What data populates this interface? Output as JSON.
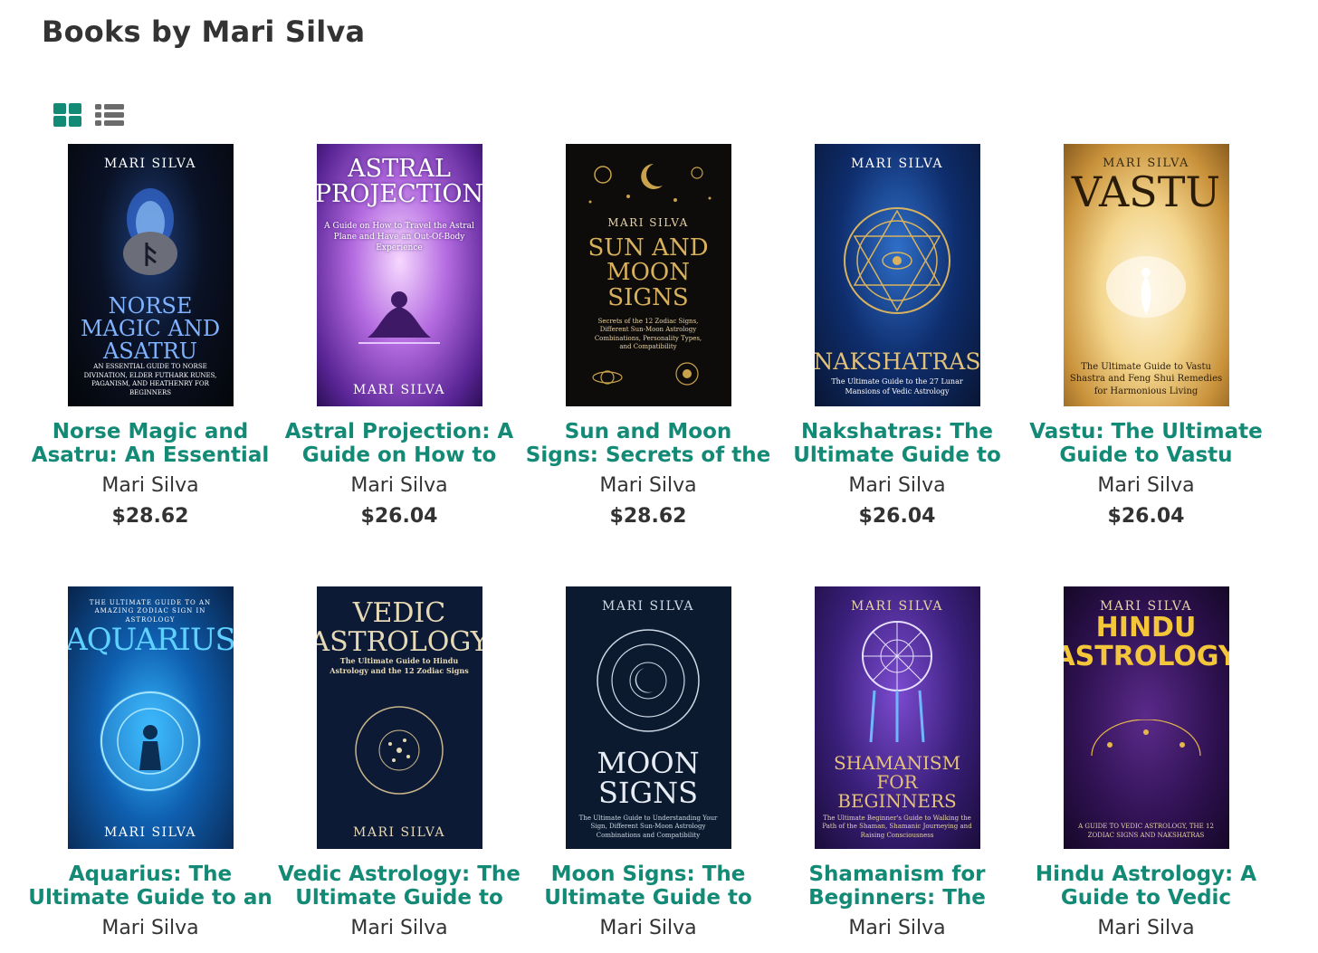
{
  "page": {
    "title": "Books by Mari Silva"
  },
  "view_toggle": {
    "grid_icon": "grid-view-icon",
    "list_icon": "list-view-icon",
    "accent_color": "#138a76"
  },
  "books": [
    {
      "title": "Norse Magic and Asatru: An Essential",
      "author": "Mari Silva",
      "price": "$28.62",
      "cover": {
        "author": "MARI SILVA",
        "title": "Norse Magic and Asatru",
        "subtitle": "An Essential Guide to Norse Divination, Elder Futhark Runes, Paganism, and Heathenry for Beginners"
      }
    },
    {
      "title": "Astral Projection: A Guide on How to",
      "author": "Mari Silva",
      "price": "$26.04",
      "cover": {
        "author": "MARI SILVA",
        "title": "Astral Projection",
        "subtitle": "A Guide on How to Travel the Astral Plane and Have an Out-Of-Body Experience"
      }
    },
    {
      "title": "Sun and Moon Signs: Secrets of the",
      "author": "Mari Silva",
      "price": "$28.62",
      "cover": {
        "author": "MARI SILVA",
        "title": "Sun and Moon Signs",
        "subtitle": "Secrets of the 12 Zodiac Signs, Different Sun-Moon Astrology Combinations, Personality Types, and Compatibility"
      }
    },
    {
      "title": "Nakshatras: The Ultimate Guide to",
      "author": "Mari Silva",
      "price": "$26.04",
      "cover": {
        "author": "MARI SILVA",
        "title": "Nakshatras",
        "subtitle": "The Ultimate Guide to the 27 Lunar Mansions of Vedic Astrology"
      }
    },
    {
      "title": "Vastu: The Ultimate Guide to Vastu",
      "author": "Mari Silva",
      "price": "$26.04",
      "cover": {
        "author": "MARI SILVA",
        "title": "Vastu",
        "subtitle": "The Ultimate Guide to Vastu Shastra and Feng Shui Remedies for Harmonious Living"
      }
    },
    {
      "title": "Aquarius: The Ultimate Guide to an",
      "author": "Mari Silva",
      "price": "",
      "cover": {
        "author": "MARI SILVA",
        "title": "Aquarius",
        "subtitle": "The Ultimate Guide to an Amazing Zodiac Sign in Astrology"
      }
    },
    {
      "title": "Vedic Astrology: The Ultimate Guide to",
      "author": "Mari Silva",
      "price": "",
      "cover": {
        "author": "MARI SILVA",
        "title": "Vedic Astrology",
        "subtitle": "The Ultimate Guide to Hindu Astrology and the 12 Zodiac Signs"
      }
    },
    {
      "title": "Moon Signs: The Ultimate Guide to",
      "author": "Mari Silva",
      "price": "",
      "cover": {
        "author": "MARI SILVA",
        "title": "Moon Signs",
        "subtitle": "The Ultimate Guide to Understanding Your Sign, Different Sun-Moon Astrology Combinations and Compatibility"
      }
    },
    {
      "title": "Shamanism for Beginners: The",
      "author": "Mari Silva",
      "price": "",
      "cover": {
        "author": "MARI SILVA",
        "title": "Shamanism for Beginners",
        "subtitle": "The Ultimate Beginner's Guide to Walking the Path of the Shaman, Shamanic Journeying and Raising Consciousness"
      }
    },
    {
      "title": "Hindu Astrology: A Guide to Vedic",
      "author": "Mari Silva",
      "price": "",
      "cover": {
        "author": "MARI SILVA",
        "title": "Hindu Astrology",
        "subtitle": "A Guide to Vedic Astrology, the 12 Zodiac Signs and Nakshatras"
      }
    }
  ]
}
